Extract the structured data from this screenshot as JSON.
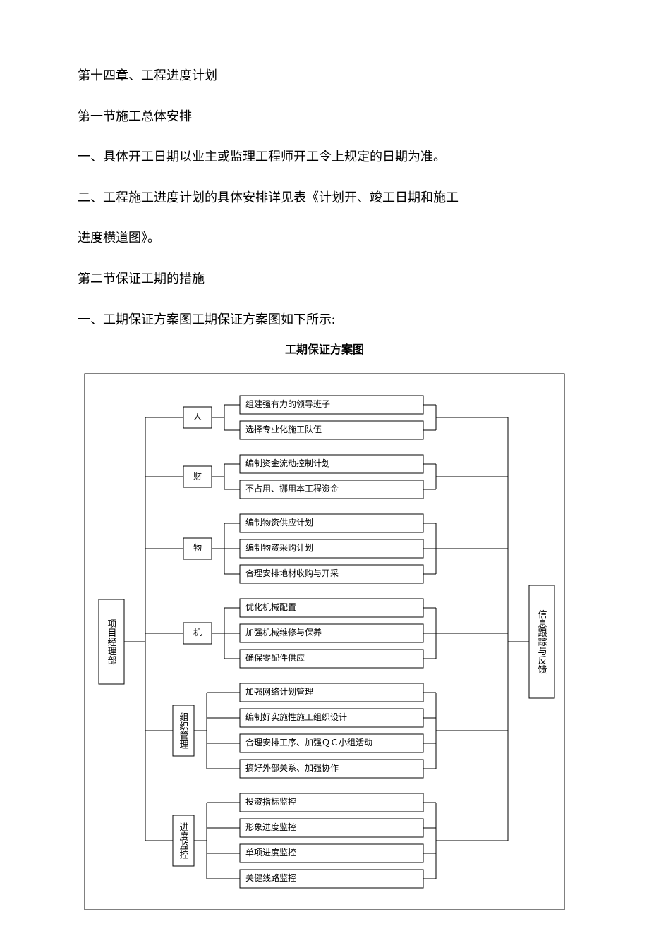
{
  "para": {
    "h1": "第十四章、工程进度计划",
    "h2a": "第一节施工总体安排",
    "p1": "一、具体开工日期以业主或监理工程师开工令上规定的日期为准。",
    "p2a": "二、工程施工进度计划的具体安排详见表《计划开、竣工日期和施工",
    "p2b": "进度横道图》。",
    "h2b": "第二节保证工期的措施",
    "p3": "一、工期保证方案图工期保证方案图如下所示:"
  },
  "chart_data": {
    "type": "tree",
    "title": "工期保证方案图",
    "left": "项目经理部",
    "right": "信息跟踪与反馈",
    "groups": [
      {
        "name": "人",
        "items": [
          "组建强有力的领导班子",
          "选择专业化施工队伍"
        ]
      },
      {
        "name": "财",
        "items": [
          "编制资金流动控制计划",
          "不占用、挪用本工程资金"
        ]
      },
      {
        "name": "物",
        "items": [
          "编制物资供应计划",
          "编制物资采购计划",
          "合理安排地材收购与开采"
        ]
      },
      {
        "name": "机",
        "items": [
          "优化机械配置",
          "加强机械维修与保养",
          "确保零配件供应"
        ]
      },
      {
        "name": "组织管理",
        "items": [
          "加强网络计划管理",
          "编制好实施性施工组织设计",
          "合理安排工序、加强ＱＣ小组活动",
          "搞好外部关系、加强协作"
        ]
      },
      {
        "name": "进度监控",
        "items": [
          "投资指标监控",
          "形象进度监控",
          "单项进度监控",
          "关健线路监控"
        ]
      }
    ]
  }
}
